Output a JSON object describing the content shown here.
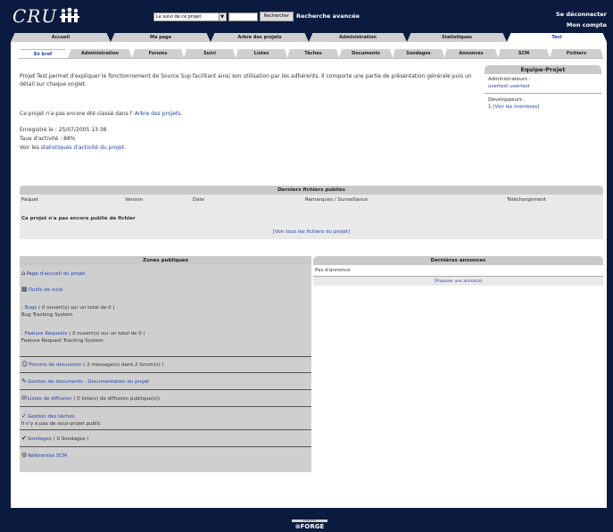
{
  "header": {
    "logo": "CRU",
    "search_select": "Le suivi de ce projet",
    "search_button": "Rechercher",
    "advanced_search": "Recherche avancée",
    "logout": "Se déconnecter",
    "account": "Mon compte"
  },
  "main_tabs": [
    "Accueil",
    "Ma page",
    "Arbre des projets",
    "Administration",
    "Statistiques",
    "Test"
  ],
  "sub_tabs": [
    "En bref",
    "Administration",
    "Forums",
    "Suivi",
    "Listes",
    "Tâches",
    "Documents",
    "Sondages",
    "Annonces",
    "SCM",
    "Fichiers"
  ],
  "summary": {
    "description": "Projet Test permet d'expliquer le fonctionnement de Source Sup facilitant ainsi son utilisation par les adhérents. Il comporte une partie de présentation générale puis un détail sur chaque onglet.",
    "not_classified_prefix": "Ce projet n'a pas encore été classé dans l' ",
    "not_classified_link": "Arbre des projets",
    "registered": "Enregistré le : 25/07/2005 13:38",
    "activity": "Taux d'activité : 88%",
    "stats_prefix": "Voir les ",
    "stats_link": "statistiques d'activité du projet",
    "stats_suffix": "."
  },
  "team": {
    "title": "Equipe-Projet",
    "admins_label": "Administrateurs :",
    "admin_user": "usertest usertest",
    "devs_label": "Développeurs :",
    "devs_count": "1",
    "members_link": "[Voir les membres]"
  },
  "files": {
    "title": "Derniers fichiers publiés",
    "columns": [
      "Paquet",
      "Version",
      "Date",
      "Remarques / Surveillance",
      "Téléchargement"
    ],
    "none": "Ce projet n'a pas encore publié de fichier",
    "see_all": "[Voir tous les fichiers du projet]"
  },
  "zones": {
    "title": "Zones publiques",
    "home": "Page d'accueil du projet",
    "tracker": "Outils de suivi",
    "bugs_link": "- Bugs",
    "bugs_text": "( 0 ouvert(s) sur un total de 0 )",
    "bugs_desc": "Bug Tracking System",
    "features_link": "- Feature Requests",
    "features_text": "( 0 ouvert(s) sur un total de 0 )",
    "features_desc": "Feature Request Tracking System",
    "forums_link": "Forums de discussion",
    "forums_text": "( 2 message(s) dans 2 forum(s) )",
    "docs_link": "Gestion de documents : Documentation du projet",
    "lists_link": "Listes de diffusion",
    "lists_text": "( 0 liste(s) de diffusion publique(s))",
    "tasks_link": "Gestion des tâches",
    "tasks_desc": "Il n'y a pas de sous-projet public",
    "polls_link": "Sondages",
    "polls_text": "( 0 Sondages )",
    "scm_link": "Référentiel SCM"
  },
  "news": {
    "title": "Dernières annonces",
    "none": "Pas d'annonce",
    "propose": "[Proposer une annonce]"
  },
  "footer": {
    "powered": "powered by",
    "forge": "FORGE"
  }
}
